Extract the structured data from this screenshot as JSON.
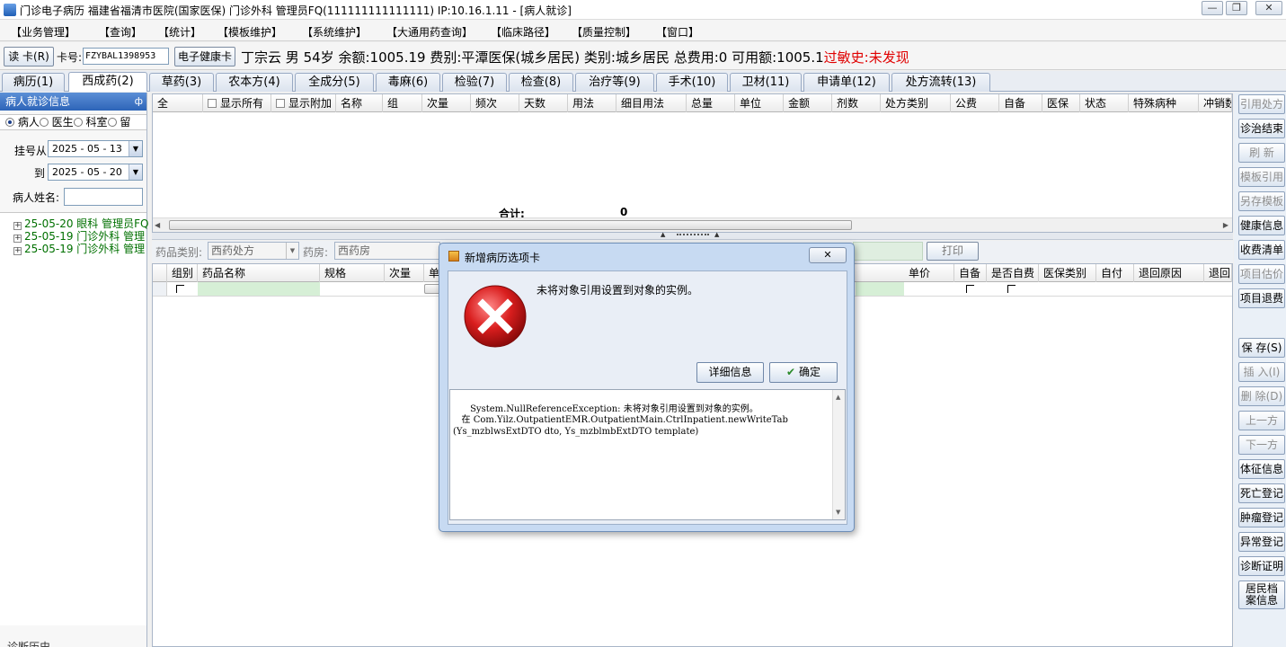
{
  "window": {
    "title": "门诊电子病历  福建省福清市医院(国家医保)  门诊外科  管理员FQ(111111111111111) IP:10.16.1.11 - [病人就诊]",
    "minimize": "—",
    "maximize": "❐",
    "close": "✕"
  },
  "menu": [
    "【业务管理】",
    "【查询】",
    "【统计】",
    "【模板维护】",
    "【系统维护】",
    "【大通用药查询】",
    "【临床路径】",
    "【质量控制】",
    "【窗口】"
  ],
  "patient": {
    "read_card_button": "读 卡(R)",
    "card_label": "卡号:",
    "card_number": "FZYBAL1398953",
    "health_card_button": "电子健康卡",
    "name": "丁宗云",
    "sex": "男",
    "age": "54岁",
    "balance": "余额:1005.19",
    "fee_type": "费别:平潭医保(城乡居民)",
    "category": "类别:城乡居民",
    "total_fee": "总费用:0",
    "available": "可用额:1005.1",
    "allergy_label": "过敏史:",
    "allergy_value": "未发现"
  },
  "tabs": [
    "病历(1)",
    "西成药(2)",
    "草药(3)",
    "农本方(4)",
    "全成分(5)",
    "毒麻(6)",
    "检验(7)",
    "检查(8)",
    "治疗等(9)",
    "手术(10)",
    "卫材(11)",
    "申请单(12)",
    "处方流转(13)"
  ],
  "left_panel": {
    "title": "病人就诊信息",
    "pin": "ф",
    "radios": [
      "病人",
      "医生",
      "科室",
      "留"
    ],
    "from_label": "挂号从",
    "from_date": "2025 - 05 - 13",
    "to_label": "到",
    "to_date": "2025 - 05 - 20",
    "name_label": "病人姓名:",
    "name_value": "",
    "visits": [
      "25-05-20  眼科  管理员FQ",
      "25-05-19  门诊外科  管理",
      "25-05-19  门诊外科  管理"
    ],
    "bottom_label": "诊断历史"
  },
  "prescription_grid": {
    "select_all": "全",
    "show_all": "显示所有",
    "show_extra": "显示附加",
    "columns": [
      "名称",
      "组",
      "次量",
      "频次",
      "天数",
      "用法",
      "细目用法",
      "总量",
      "单位",
      "金额",
      "剂数",
      "处方类别",
      "公费",
      "自备",
      "医保",
      "状态",
      "特殊病种",
      "冲销数"
    ],
    "total_label": "合计:",
    "total_value": "0"
  },
  "drug_entry": {
    "category_label": "药品类别:",
    "category_value": "西药处方",
    "pharmacy_label": "药房:",
    "pharmacy_value": "西药房",
    "print_button": "打印",
    "columns_left": [
      "组别",
      "药品名称",
      "规格",
      "次量",
      "单"
    ],
    "columns_right": [
      "单价",
      "自备",
      "是否自费",
      "医保类别",
      "自付",
      "退回原因",
      "退回"
    ]
  },
  "right_toolbar": [
    {
      "label": "引用处方",
      "enabled": false
    },
    {
      "label": "诊治结束",
      "enabled": true
    },
    {
      "label": "刷 新",
      "enabled": false
    },
    {
      "label": "模板引用",
      "enabled": false
    },
    {
      "label": "另存模板",
      "enabled": false
    },
    {
      "label": "健康信息",
      "enabled": true
    },
    {
      "label": "收费清单",
      "enabled": true
    },
    {
      "label": "项目估价",
      "enabled": false
    },
    {
      "label": "项目退费",
      "enabled": true
    },
    {
      "label": "保 存(S)",
      "enabled": true
    },
    {
      "label": "插 入(I)",
      "enabled": false
    },
    {
      "label": "删 除(D)",
      "enabled": false
    },
    {
      "label": "上一方",
      "enabled": false
    },
    {
      "label": "下一方",
      "enabled": false
    },
    {
      "label": "体征信息",
      "enabled": true
    },
    {
      "label": "死亡登记",
      "enabled": true
    },
    {
      "label": "肿瘤登记",
      "enabled": true
    },
    {
      "label": "异常登记",
      "enabled": true
    },
    {
      "label": "诊断证明",
      "enabled": true
    },
    {
      "label": "居民档案信息",
      "enabled": true
    }
  ],
  "dialog": {
    "title": "新增病历选项卡",
    "close": "✕",
    "message": "未将对象引用设置到对象的实例。",
    "details_button": "详细信息",
    "ok_button": "确定",
    "details_text": "System.NullReferenceException: 未将对象引用设置到对象的实例。\n   在 Com.Yilz.OutpatientEMR.OutpatientMain.CtrlInpatient.newWriteTab\n(Ys_mzblwsExtDTO dto, Ys_mzblmbExtDTO template)"
  },
  "colors": {
    "error_red": "#d91e1e",
    "allergy_red": "#e00000",
    "visit_green": "#007000",
    "panel_header_blue": "#2d64b8"
  }
}
